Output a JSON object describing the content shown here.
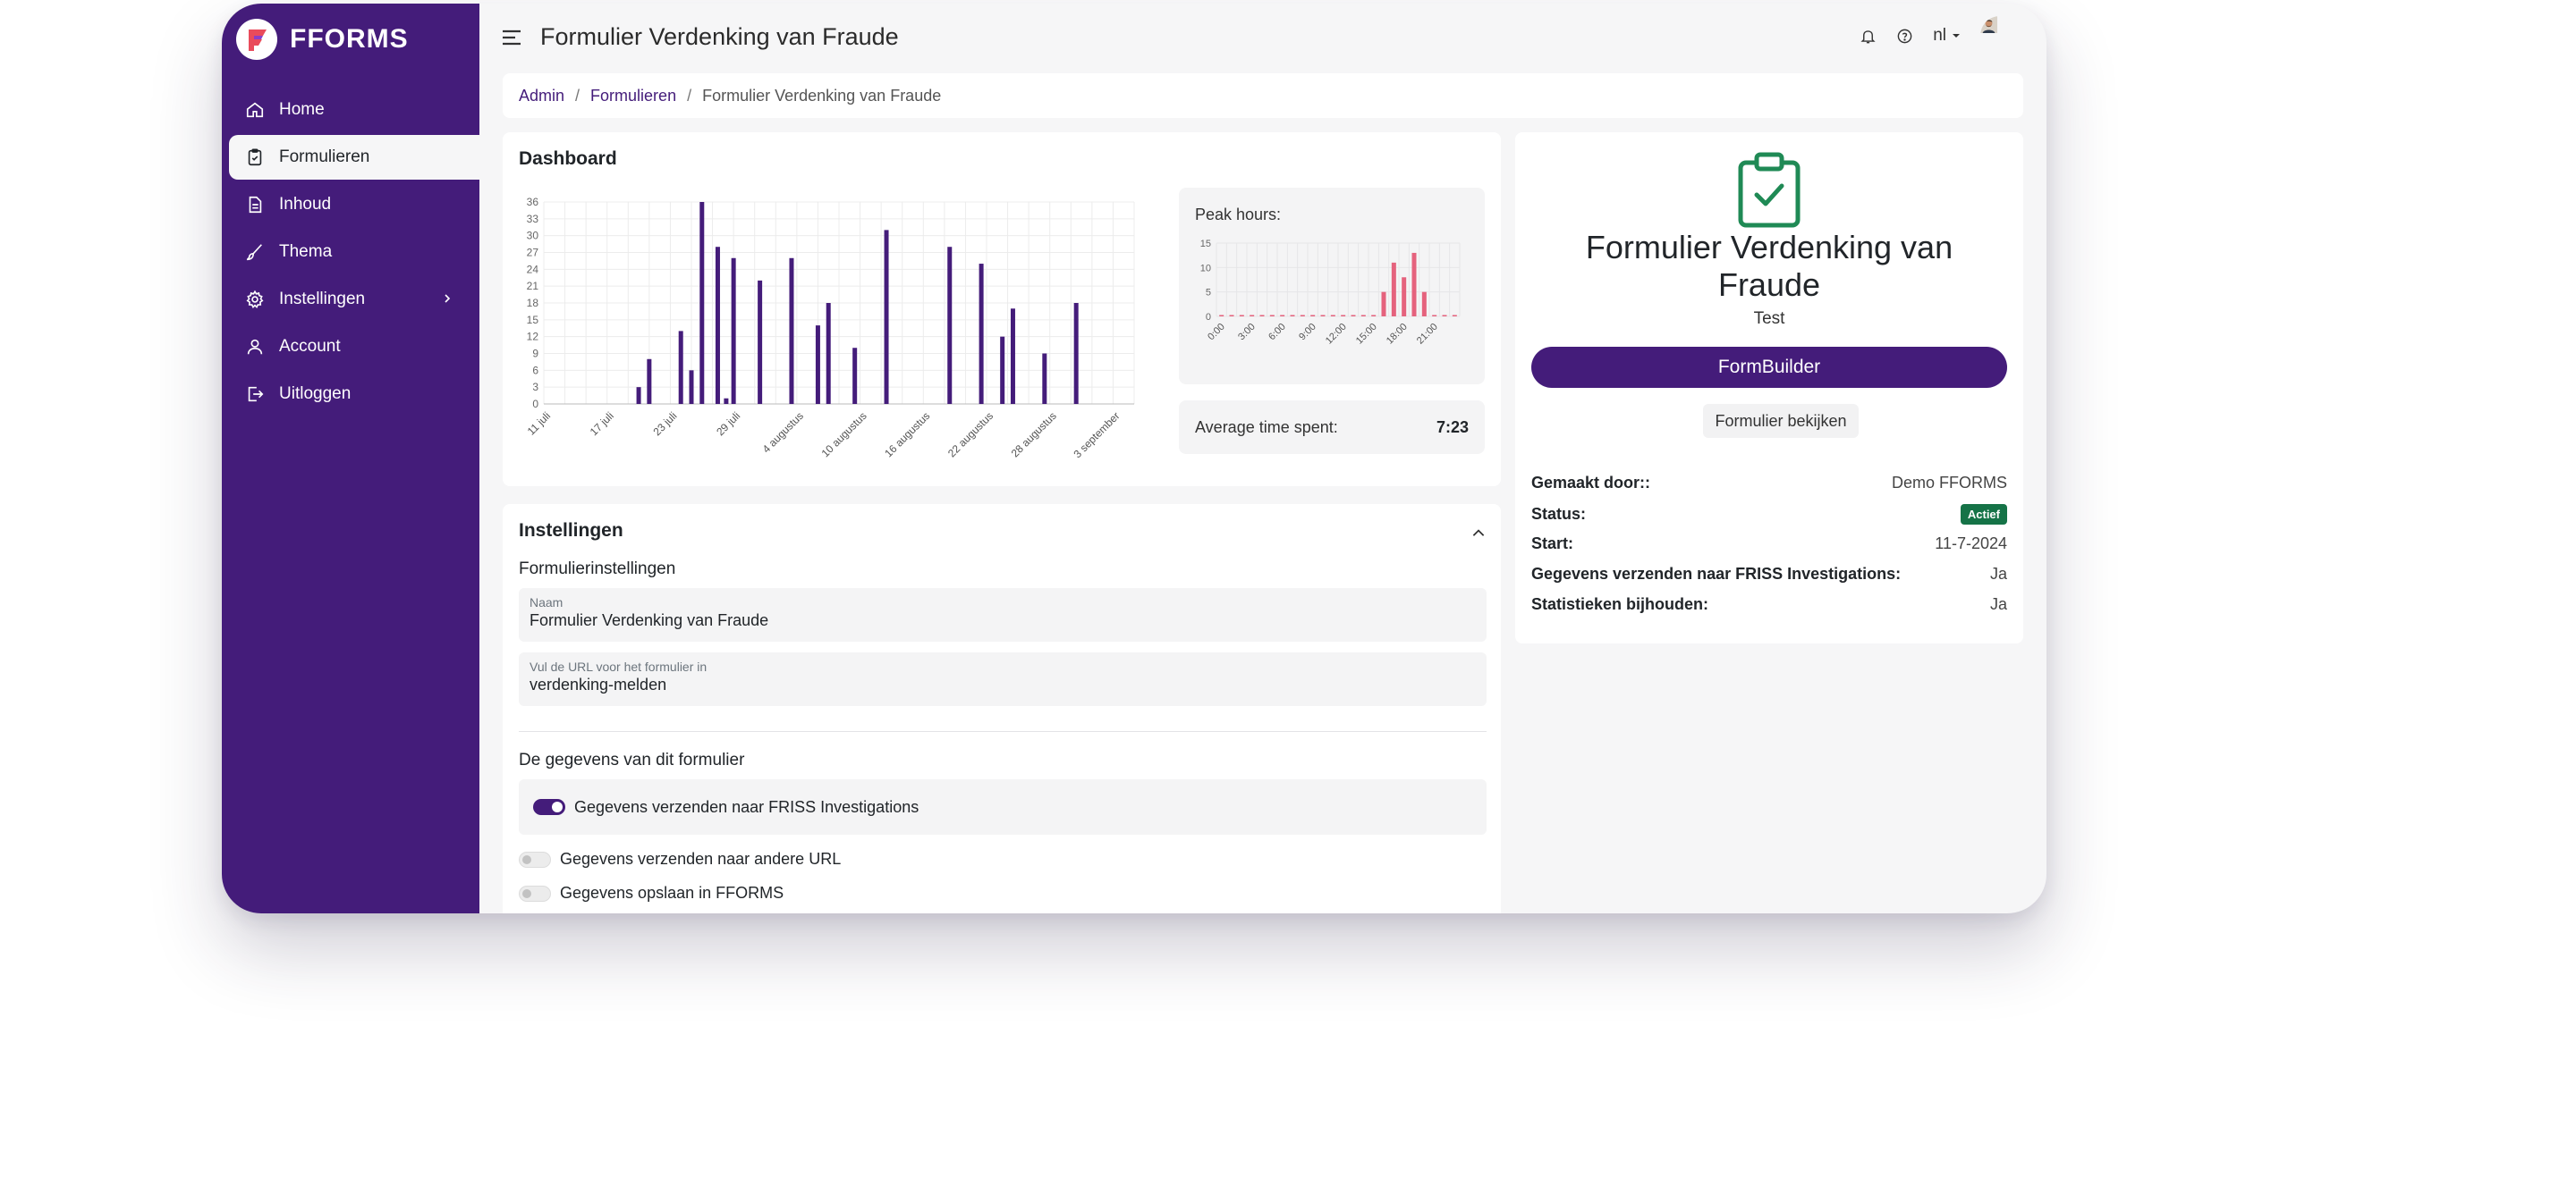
{
  "brand": {
    "name": "FFORMS"
  },
  "sidebar": {
    "items": [
      {
        "label": "Home",
        "icon": "home-icon"
      },
      {
        "label": "Formulieren",
        "icon": "clipboard-icon",
        "active": true
      },
      {
        "label": "Inhoud",
        "icon": "document-icon"
      },
      {
        "label": "Thema",
        "icon": "brush-icon"
      },
      {
        "label": "Instellingen",
        "icon": "gear-icon"
      },
      {
        "label": "Account",
        "icon": "user-icon"
      },
      {
        "label": "Uitloggen",
        "icon": "logout-icon"
      }
    ]
  },
  "header": {
    "title": "Formulier Verdenking van Fraude",
    "language": "nl"
  },
  "breadcrumb": {
    "items": [
      "Admin",
      "Formulieren",
      "Formulier Verdenking van Fraude"
    ]
  },
  "dashboard": {
    "title": "Dashboard",
    "peak_label": "Peak hours:",
    "avg_label": "Average time spent:",
    "avg_value": "7:23"
  },
  "chart_data": [
    {
      "type": "bar",
      "categories": [
        "11 juli",
        "17 juli",
        "23 juli",
        "29 juli",
        "4 augustus",
        "10 augustus",
        "16 augustus",
        "22 augustus",
        "28 augustus",
        "3 september"
      ],
      "ylim": [
        0,
        36
      ],
      "yticks": [
        0,
        3,
        6,
        9,
        12,
        15,
        18,
        21,
        24,
        27,
        30,
        33,
        36
      ],
      "x_index_range": [
        0,
        56
      ],
      "bars": [
        {
          "x": 9,
          "y": 3
        },
        {
          "x": 10,
          "y": 8
        },
        {
          "x": 13,
          "y": 13
        },
        {
          "x": 14,
          "y": 6
        },
        {
          "x": 15,
          "y": 36
        },
        {
          "x": 16.5,
          "y": 28
        },
        {
          "x": 17.3,
          "y": 1
        },
        {
          "x": 18,
          "y": 26
        },
        {
          "x": 20.5,
          "y": 22
        },
        {
          "x": 23.5,
          "y": 26
        },
        {
          "x": 26,
          "y": 14
        },
        {
          "x": 27,
          "y": 18
        },
        {
          "x": 29.5,
          "y": 10
        },
        {
          "x": 32.5,
          "y": 31
        },
        {
          "x": 38.5,
          "y": 28
        },
        {
          "x": 41.5,
          "y": 25
        },
        {
          "x": 43.5,
          "y": 12
        },
        {
          "x": 44.5,
          "y": 17
        },
        {
          "x": 47.5,
          "y": 9
        },
        {
          "x": 50.5,
          "y": 18
        }
      ],
      "color": "#441c7a"
    },
    {
      "type": "bar",
      "categories": [
        "0:00",
        "3:00",
        "6:00",
        "9:00",
        "12:00",
        "15:00",
        "18:00",
        "21:00"
      ],
      "ylim": [
        0,
        15
      ],
      "yticks": [
        0,
        5,
        10,
        15
      ],
      "values": [
        0,
        0,
        0,
        0,
        0,
        0,
        0,
        0,
        0,
        0,
        0,
        0,
        0,
        0,
        0,
        0,
        5,
        11,
        8,
        13,
        5,
        0,
        0,
        0
      ],
      "color": "#e5627d"
    }
  ],
  "settings": {
    "title": "Instellingen",
    "section": "Formulierinstellingen",
    "name_label": "Naam",
    "name_value": "Formulier Verdenking van Fraude",
    "url_label": "Vul de URL voor het formulier in",
    "url_value": "verdenking-melden",
    "data_section": "De gegevens van dit formulier",
    "toggles": [
      {
        "label": "Gegevens verzenden naar FRISS Investigations",
        "on": true
      },
      {
        "label": "Gegevens verzenden naar andere URL",
        "on": false
      },
      {
        "label": "Gegevens opslaan in FFORMS",
        "on": false
      }
    ]
  },
  "info": {
    "title": "Formulier Verdenking van Fraude",
    "subtitle": "Test",
    "primary_button": "FormBuilder",
    "secondary_button": "Formulier bekijken",
    "meta": [
      {
        "key": "Gemaakt door::",
        "value": "Demo FFORMS"
      },
      {
        "key": "Status:",
        "value": "Actief"
      },
      {
        "key": "Start:",
        "value": "11-7-2024"
      },
      {
        "key": "Gegevens verzenden naar FRISS Investigations:",
        "value": "Ja"
      },
      {
        "key": "Statistieken bijhouden:",
        "value": "Ja"
      }
    ],
    "accent": "#1f8a55"
  }
}
